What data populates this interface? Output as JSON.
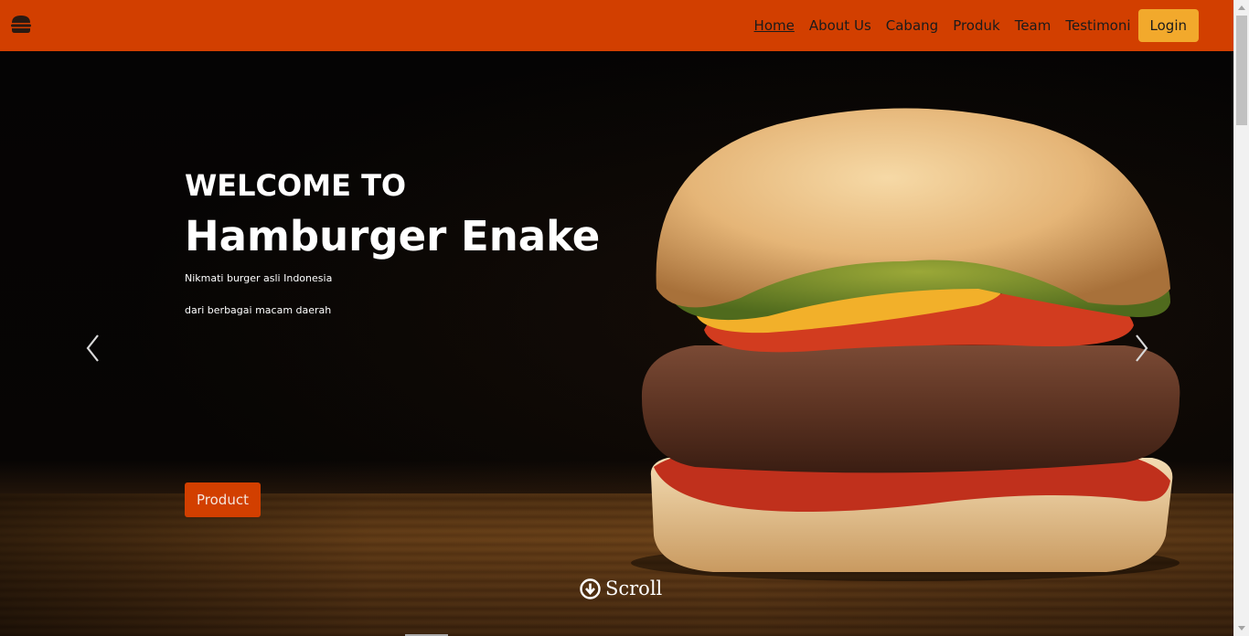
{
  "nav": {
    "brand_icon": "hamburger-icon",
    "items": [
      {
        "label": "Home",
        "active": true
      },
      {
        "label": "About Us",
        "active": false
      },
      {
        "label": "Cabang",
        "active": false
      },
      {
        "label": "Produk",
        "active": false
      },
      {
        "label": "Team",
        "active": false
      },
      {
        "label": "Testimoni",
        "active": false
      }
    ],
    "login_label": "Login"
  },
  "hero": {
    "welcome": "WELCOME TO",
    "title": "Hamburger Enake",
    "line1": "Nikmati burger asli Indonesia",
    "line2": "dari berbagai macam daerah",
    "product_button": "Product",
    "scroll_label": "Scroll",
    "prev_icon": "chevron-left-icon",
    "next_icon": "chevron-right-icon",
    "scroll_icon": "arrow-down-circle-icon"
  },
  "colors": {
    "navbar": "#d23f00",
    "login_button": "#f2a92c",
    "product_button": "#d23f00"
  }
}
